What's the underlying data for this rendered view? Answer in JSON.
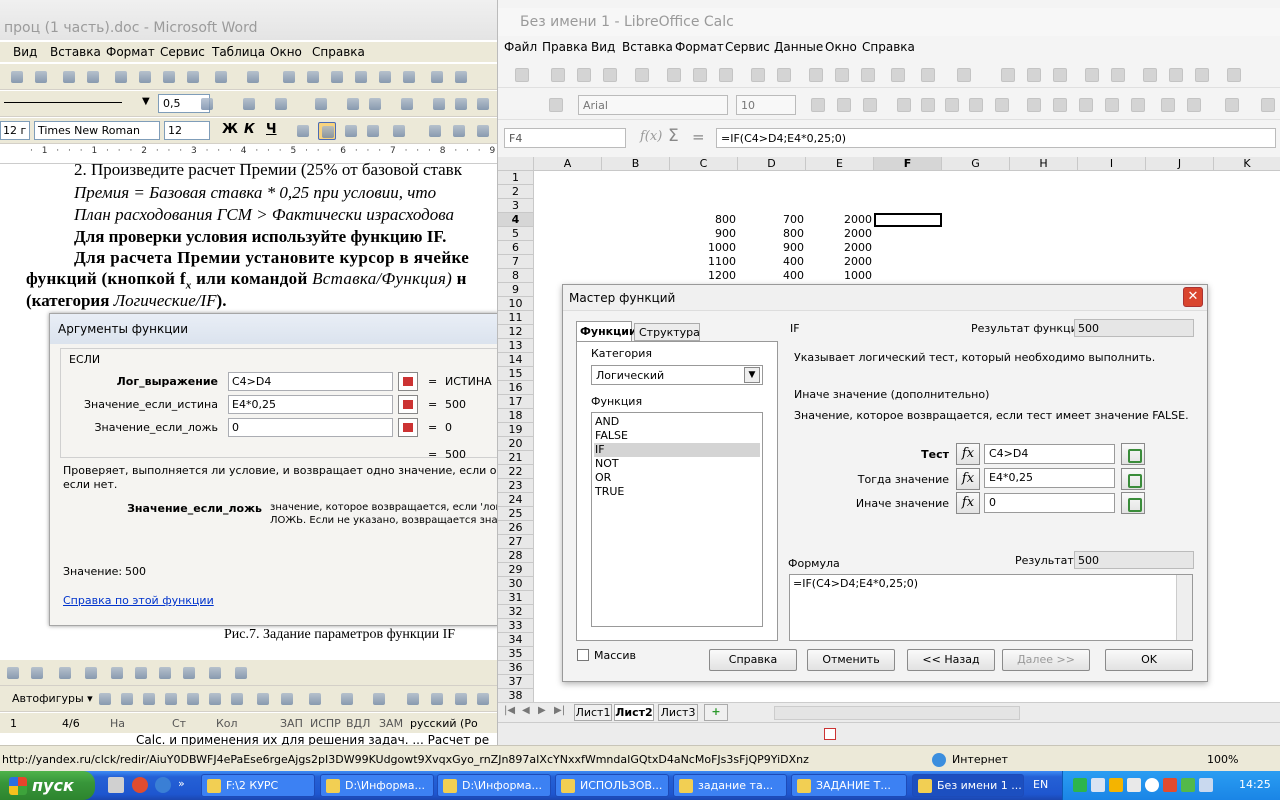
{
  "word": {
    "title": "проц (1 часть).doc - Microsoft Word",
    "menu": [
      "Вид",
      "Вставка",
      "Формат",
      "Сервис",
      "Таблица",
      "Окно",
      "Справка"
    ],
    "zoom_value": "0,5",
    "style_box": "12 г",
    "font_name": "Times New Roman",
    "font_size": "12",
    "format_buttons": {
      "bold": "Ж",
      "italic": "К",
      "underline": "Ч"
    },
    "doc_lines": [
      "2. Произведите расчет Премии (25% от базовой ставк",
      "Премия = Базовая ставка * 0,25 при условии, что",
      "План расходования ГСМ > Фактически израсходова",
      "Для проверки условия используйте функцию IF.",
      "Для расчета Премии установите курсор в ячейке",
      "функций (кнопкой f",
      "x",
      " или командой ",
      "Вставка/Функция)",
      " н",
      "(категория ",
      "Логические/IF",
      ")."
    ],
    "figure_caption": "Рис.7. Задание параметров функции IF",
    "drawing_toolbar": {
      "autoshapes": "Автофигуры ▾"
    },
    "status": {
      "page": "1",
      "pages": "4/6",
      "at": "На",
      "line": "Ст",
      "col": "Кол",
      "rec": "ЗАП",
      "trk": "ИСПР",
      "ext": "ВДЛ",
      "ovr": "ЗАМ",
      "lang": "русский (Ро"
    },
    "bottom_text": "Calc. и применения их для решения задач. ... Расчет ре"
  },
  "word_dialog": {
    "title": "Аргументы функции",
    "group": "ЕСЛИ",
    "args": [
      {
        "label": "Лог_выражение",
        "value": "C4>D4",
        "result": "ИСТИНА"
      },
      {
        "label": "Значение_если_истина",
        "value": "E4*0,25",
        "result": "500"
      },
      {
        "label": "Значение_если_ложь",
        "value": "0",
        "result": "0"
      }
    ],
    "eq": "=",
    "total_result": "500",
    "description": "Проверяет, выполняется ли условие, и возвращает одно значение, если оно выпол",
    "description2": "если нет.",
    "param_name": "Значение_если_ложь",
    "param_desc1": "значение, которое возвращается, если 'лог",
    "param_desc2": "ЛОЖЬ. Если не указано, возвращается знач",
    "value_label": "Значение:",
    "value": "500",
    "help_link": "Справка по этой функции"
  },
  "calc": {
    "title": "Без имени 1 - LibreOffice Calc",
    "menu": [
      "Файл",
      "Правка",
      "Вид",
      "Вставка",
      "Формат",
      "Сервис",
      "Данные",
      "Окно",
      "Справка"
    ],
    "font_name": "Arial",
    "font_size": "10",
    "name_box": "F4",
    "formula": "=IF(C4>D4;E4*0,25;0)",
    "columns": [
      "A",
      "B",
      "C",
      "D",
      "E",
      "F",
      "G",
      "H",
      "I",
      "J",
      "K"
    ],
    "rows": [
      "1",
      "2",
      "3",
      "4",
      "5",
      "6",
      "7",
      "8",
      "9",
      "10",
      "11",
      "12",
      "13",
      "14",
      "15",
      "16",
      "17",
      "18",
      "19",
      "20",
      "21",
      "22",
      "23",
      "24",
      "25",
      "26",
      "27",
      "28",
      "29",
      "30",
      "31",
      "32",
      "33",
      "34",
      "35",
      "36",
      "37",
      "38"
    ],
    "data": [
      {
        "row": "4",
        "C": "800",
        "D": "700",
        "E": "2000"
      },
      {
        "row": "5",
        "C": "900",
        "D": "800",
        "E": "2000"
      },
      {
        "row": "6",
        "C": "1000",
        "D": "900",
        "E": "2000"
      },
      {
        "row": "7",
        "C": "1100",
        "D": "400",
        "E": "2000"
      },
      {
        "row": "8",
        "C": "1200",
        "D": "400",
        "E": "1000"
      }
    ],
    "sheets": [
      "Лист1",
      "Лист2",
      "Лист3"
    ],
    "add_sheet": "+"
  },
  "calc_dialog": {
    "title": "Мастер функций",
    "tabs": [
      "Функции",
      "Структура"
    ],
    "category_label": "Категория",
    "category_value": "Логический",
    "function_label": "Функция",
    "functions": [
      "AND",
      "FALSE",
      "IF",
      "NOT",
      "OR",
      "TRUE"
    ],
    "selected_function": "IF",
    "func_name": "IF",
    "func_result_label": "Результат функции",
    "func_result": "500",
    "func_desc": "Указывает логический тест, который необходимо выполнить.",
    "param_title": "Иначе значение (дополнительно)",
    "param_desc": "Значение, которое возвращается, если тест имеет значение FALSE.",
    "fx": "fx",
    "args": [
      {
        "label": "Тест",
        "value": "C4>D4"
      },
      {
        "label": "Тогда значение",
        "value": "E4*0,25"
      },
      {
        "label": "Иначе значение",
        "value": "0"
      }
    ],
    "formula_label": "Формула",
    "result_label": "Результат",
    "result": "500",
    "formula": "=IF(C4>D4;E4*0,25;0)",
    "array_label": "Массив",
    "buttons": {
      "help": "Справка",
      "cancel": "Отменить",
      "back": "<< Назад",
      "next": "Далее >>",
      "ok": "OK"
    }
  },
  "ie_status": {
    "url": "http://yandex.ru/clck/redir/AiuY0DBWFJ4ePaEse6rgeAjgs2pI3DW99KUdgowt9XvqxGyo_rnZJn897aIXcYNxxfWmndaIGQtxD4aNcMoFJs3sFjQP9YiDXnz",
    "zone": "Интернет",
    "zoom": "100%"
  },
  "taskbar": {
    "start": "пуск",
    "tasks": [
      "F:\\2 КУРС",
      "D:\\Информа...",
      "D:\\Информа...",
      "ИСПОЛЬЗОВ...",
      "задание та...",
      "ЗАДАНИЕ Т...",
      "Без имени 1 ..."
    ],
    "lang": "EN",
    "clock": "14:25"
  },
  "colors": {
    "xp_blue": "#245edb",
    "start_green": "#3c9b3c",
    "selection": "#d4d4d4"
  }
}
